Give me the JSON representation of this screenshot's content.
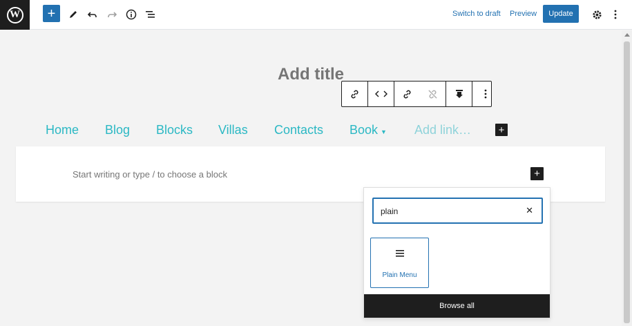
{
  "topbar": {
    "logo": "W",
    "add_block_icon": "plus-icon",
    "tools_icon": "pencil-icon",
    "undo_icon": "undo-icon",
    "redo_icon": "redo-icon",
    "details_icon": "info-icon",
    "outline_icon": "list-view-icon",
    "switch_to_draft": "Switch to draft",
    "preview": "Preview",
    "update": "Update",
    "settings_icon": "gear-icon",
    "options_icon": "more-vertical-icon"
  },
  "editor": {
    "title_placeholder": "Add title",
    "paragraph_placeholder": "Start writing or type / to choose a block"
  },
  "block_toolbar": {
    "buttons": [
      "link-icon",
      "code-icon",
      "link-icon",
      "unlink-icon",
      "submenu-icon",
      "more-vertical-icon"
    ]
  },
  "nav": {
    "items": [
      {
        "label": "Home"
      },
      {
        "label": "Blog"
      },
      {
        "label": "Blocks"
      },
      {
        "label": "Villas"
      },
      {
        "label": "Contacts"
      },
      {
        "label": "Book",
        "has_submenu": true
      }
    ],
    "add_link_placeholder": "Add link…"
  },
  "inserter": {
    "search_value": "plain",
    "results": [
      {
        "label": "Plain Menu",
        "icon": "menu-icon"
      }
    ],
    "browse_all": "Browse all"
  },
  "colors": {
    "accent": "#2271b1",
    "nav_link": "#2bb8c4",
    "dark": "#1e1e1e"
  }
}
